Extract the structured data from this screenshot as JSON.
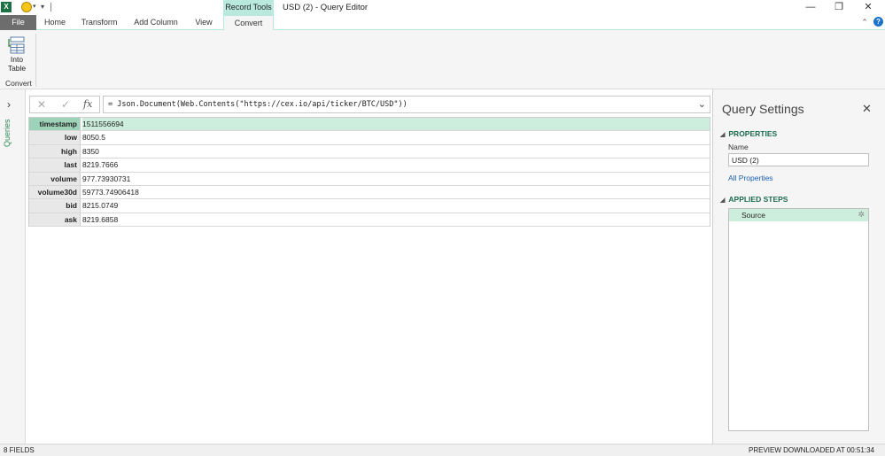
{
  "titlebar": {
    "app_icon": "excel-icon",
    "contextual_tab": "Record Tools",
    "window_title": "USD (2) - Query Editor",
    "minimize_glyph": "—",
    "restore_glyph": "❐",
    "close_glyph": "✕"
  },
  "ribbon": {
    "tabs": {
      "file": "File",
      "home": "Home",
      "transform": "Transform",
      "add_column": "Add Column",
      "view": "View",
      "convert": "Convert"
    },
    "active_tab": "Convert",
    "into_table_line1": "Into",
    "into_table_line2": "Table",
    "group_label": "Convert",
    "help_glyph": "?",
    "collapse_glyph": "⌃"
  },
  "queries_rail": {
    "label": "Queries",
    "expand_glyph": "›"
  },
  "formula_bar": {
    "cancel_glyph": "✕",
    "commit_glyph": "✓",
    "fx_glyph": "fx",
    "formula": "= Json.Document(Web.Contents(\"https://cex.io/api/ticker/BTC/USD\"))",
    "dropdown_glyph": "⌄"
  },
  "record": {
    "rows": [
      {
        "key": "timestamp",
        "value": "1511556694"
      },
      {
        "key": "low",
        "value": "8050.5"
      },
      {
        "key": "high",
        "value": "8350"
      },
      {
        "key": "last",
        "value": "8219.7666"
      },
      {
        "key": "volume",
        "value": "977.73930731"
      },
      {
        "key": "volume30d",
        "value": "59773.74906418"
      },
      {
        "key": "bid",
        "value": "8215.0749"
      },
      {
        "key": "ask",
        "value": "8219.6858"
      }
    ],
    "selected_row": 0
  },
  "query_settings": {
    "title": "Query Settings",
    "close_glyph": "✕",
    "properties_heading": "PROPERTIES",
    "name_label": "Name",
    "name_value": "USD (2)",
    "all_properties_link": "All Properties",
    "applied_steps_heading": "APPLIED STEPS",
    "steps": [
      {
        "label": "Source",
        "icon": "gear-icon"
      }
    ]
  },
  "statusbar": {
    "fields": "8 FIELDS",
    "preview": "PREVIEW DOWNLOADED AT 00:51:34"
  },
  "colors": {
    "accent": "#1e6b4e",
    "selected_row": "#cdeedd",
    "contextual_tab": "#b9e9dd",
    "file_tab": "#6d6d6d"
  }
}
